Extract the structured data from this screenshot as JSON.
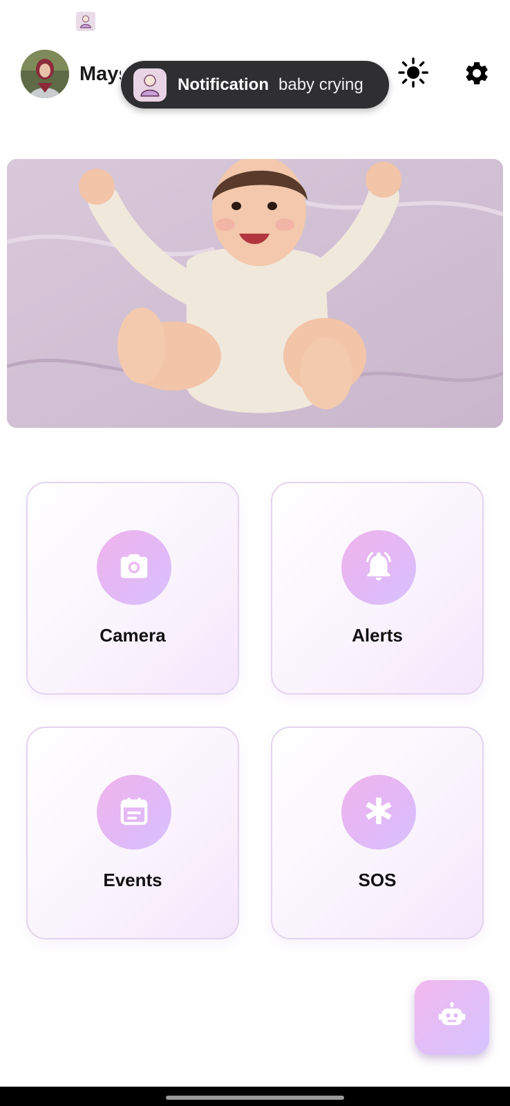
{
  "header": {
    "user_name": "Mays",
    "avatar_icon": "user-avatar",
    "theme_icon": "sun-icon",
    "settings_icon": "gear-icon"
  },
  "notification": {
    "title": "Notification",
    "text": "baby crying",
    "icon": "baby-app-icon"
  },
  "hero": {
    "image": "smiling-baby-photo"
  },
  "features": [
    {
      "label": "Camera",
      "icon": "camera-icon"
    },
    {
      "label": "Alerts",
      "icon": "bell-icon"
    },
    {
      "label": "Events",
      "icon": "calendar-icon"
    },
    {
      "label": "SOS",
      "icon": "asterisk-icon"
    }
  ],
  "fab": {
    "icon": "robot-icon"
  },
  "colors": {
    "accent_pink": "#f0b4ec",
    "accent_lavender": "#d7c2ff",
    "card_border": "#e3d4ee",
    "notification_bg": "#2f2f31"
  }
}
